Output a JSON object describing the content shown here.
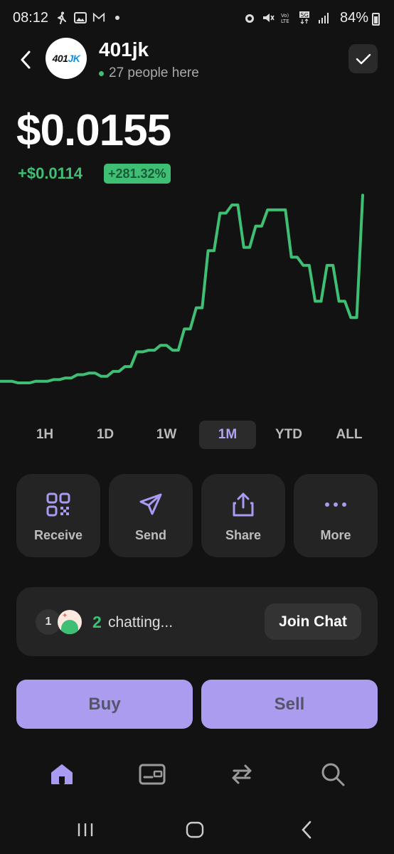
{
  "status_bar": {
    "time": "08:12",
    "battery": "84%",
    "left_icons": [
      "walk-icon",
      "image-icon",
      "mail-icon",
      "dot-icon"
    ],
    "right_icons": [
      "alarm-icon",
      "mute-icon",
      "volte-icon",
      "5g-icon",
      "signal-icon"
    ]
  },
  "header": {
    "token_name": "401jk",
    "logo_text_a": "401",
    "logo_text_b": "JK",
    "people_here": "27 people here"
  },
  "price": {
    "value": "$0.0155",
    "change": "+$0.0114",
    "change_pct": "+281.32%"
  },
  "colors": {
    "accent_green": "#3fbf74",
    "accent_purple": "#ab9cf0",
    "background": "#121212",
    "card": "#242424"
  },
  "chart_data": {
    "type": "line",
    "title": "",
    "xlabel": "",
    "ylabel": "",
    "timeframe": "1M",
    "grid": false,
    "y_note": "price trend over the selected period",
    "values": [
      0.0041,
      0.0041,
      0.0041,
      0.004,
      0.004,
      0.004,
      0.0041,
      0.0041,
      0.0041,
      0.0042,
      0.0042,
      0.0043,
      0.0043,
      0.0045,
      0.0045,
      0.0046,
      0.0046,
      0.0044,
      0.0044,
      0.0047,
      0.0047,
      0.005,
      0.005,
      0.0059,
      0.0059,
      0.006,
      0.006,
      0.0063,
      0.0063,
      0.006,
      0.006,
      0.0073,
      0.0073,
      0.0086,
      0.0086,
      0.0121,
      0.0121,
      0.0144,
      0.0144,
      0.0149,
      0.0149,
      0.0123,
      0.0123,
      0.0136,
      0.0136,
      0.0146,
      0.0146,
      0.0146,
      0.0146,
      0.0117,
      0.0117,
      0.0112,
      0.0112,
      0.009,
      0.009,
      0.0112,
      0.0112,
      0.009,
      0.009,
      0.008,
      0.008,
      0.0155
    ]
  },
  "timeframes": [
    "1H",
    "1D",
    "1W",
    "1M",
    "YTD",
    "ALL"
  ],
  "active_timeframe": "1M",
  "actions": [
    {
      "label": "Receive",
      "icon": "qr-code-icon"
    },
    {
      "label": "Send",
      "icon": "send-icon"
    },
    {
      "label": "Share",
      "icon": "share-icon"
    },
    {
      "label": "More",
      "icon": "more-icon"
    }
  ],
  "chat": {
    "unread": "1",
    "count": "2",
    "text": "chatting...",
    "join_label": "Join Chat"
  },
  "trade": {
    "buy_label": "Buy",
    "sell_label": "Sell"
  },
  "tabs": [
    {
      "name": "home",
      "icon": "home-icon",
      "active": true
    },
    {
      "name": "wallet",
      "icon": "wallet-icon",
      "active": false
    },
    {
      "name": "swap",
      "icon": "swap-icon",
      "active": false
    },
    {
      "name": "search",
      "icon": "search-icon",
      "active": false
    }
  ],
  "android_nav": [
    "recents-icon",
    "home-button-icon",
    "back-icon"
  ]
}
